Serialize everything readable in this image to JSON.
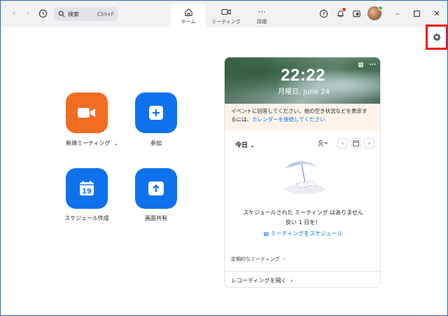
{
  "search": {
    "placeholder": "検索",
    "shortcut": "Ctrl+F"
  },
  "tabs": [
    {
      "label": "ホーム",
      "icon": "home-icon",
      "active": true
    },
    {
      "label": "ミーティング",
      "icon": "video-icon",
      "active": false
    },
    {
      "label": "詳細",
      "icon": "more-icon",
      "active": false
    }
  ],
  "actions": {
    "new_meeting": "新規ミーティング",
    "join": "参加",
    "schedule": "スケジュール作成",
    "schedule_day": "19",
    "share_screen": "画面共有"
  },
  "calendar": {
    "time": "22:22",
    "date": "月曜日, June 24",
    "notice_line1": "イベントに回答してください。他の空き状況などを表示す",
    "notice_line2_prefix": "るには、",
    "notice_link": "カレンダーを接続してください",
    "today_label": "今日",
    "empty_line1": "スケジュールされた ミーティング はありません",
    "empty_line2": "良い 1 日を！",
    "schedule_meeting_link": "ミーティングをスケジュール",
    "recurring_label": "定期的なミーティング",
    "open_recordings": "レコーディングを開く"
  },
  "colors": {
    "accent_blue": "#0e72ed",
    "accent_orange": "#f26d21",
    "highlight_red": "#ee1111"
  }
}
